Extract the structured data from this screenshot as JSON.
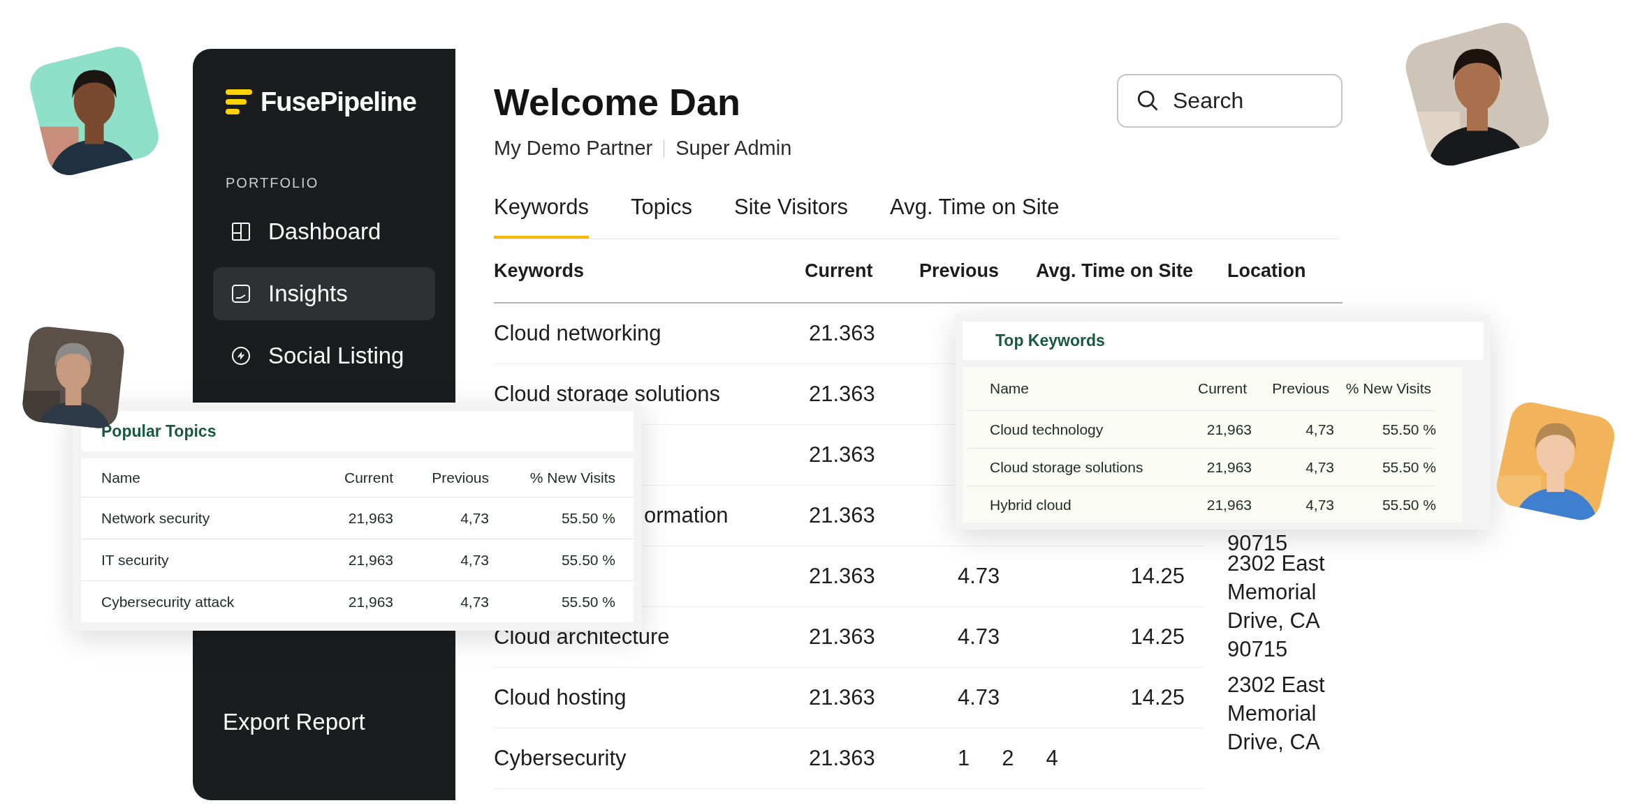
{
  "sidebar": {
    "logo": "FusePipeline",
    "section": "PORTFOLIO",
    "items": [
      {
        "label": "Dashboard",
        "kind": "dashboard",
        "selected": false
      },
      {
        "label": "Insights",
        "kind": "insights",
        "selected": true
      },
      {
        "label": "Social Listing",
        "kind": "social",
        "selected": false
      }
    ],
    "footer": "Export Report"
  },
  "header": {
    "title": "Welcome Dan",
    "organization": "My Demo Partner",
    "role": "Super Admin",
    "search": {
      "placeholder": "Search"
    }
  },
  "tabs": [
    {
      "label": "Keywords",
      "selected": true
    },
    {
      "label": "Topics",
      "selected": false
    },
    {
      "label": "Site Visitors",
      "selected": false
    },
    {
      "label": "Avg. Time on Site",
      "selected": false
    }
  ],
  "table": {
    "columns": [
      "Keywords",
      "Current",
      "Previous",
      "Avg. Time on Site",
      "Location"
    ],
    "rows": [
      {
        "keyword": "Cloud networking",
        "current": "21.363"
      },
      {
        "keyword": "Cloud storage solutions",
        "current": "21.363"
      },
      {
        "current": "21.363"
      },
      {
        "keyword": "ormation",
        "current": "21.363",
        "location": "90715",
        "kind": "cut"
      },
      {
        "current": "21.363",
        "previous": "4.73",
        "avg_time": "14.25",
        "location": "2302 East Memorial Drive, CA 90715"
      },
      {
        "keyword": "Cloud architecture",
        "current": "21.363",
        "previous": "4.73",
        "avg_time": "14.25"
      },
      {
        "keyword": "Cloud hosting",
        "current": "21.363",
        "previous": "4.73",
        "avg_time": "14.25",
        "location": "2302 East Memorial Drive, CA"
      },
      {
        "keyword": "Cybersecurity",
        "current": "21.363",
        "pages": [
          "1",
          "2",
          "4"
        ]
      }
    ]
  },
  "popular_topics": {
    "title": "Popular Topics",
    "columns": [
      "Name",
      "Current",
      "Previous",
      "% New Visits"
    ],
    "rows": [
      {
        "name": "Network security",
        "current": "21,963",
        "previous": "4,73",
        "new_visits": "55.50 %"
      },
      {
        "name": "IT security",
        "current": "21,963",
        "previous": "4,73",
        "new_visits": "55.50 %"
      },
      {
        "name": "Cybersecurity attack",
        "current": "21,963",
        "previous": "4,73",
        "new_visits": "55.50 %"
      }
    ]
  },
  "top_keywords": {
    "title": "Top Keywords",
    "columns": [
      "Name",
      "Current",
      "Previous",
      "% New Visits"
    ],
    "rows": [
      {
        "name": "Cloud technology",
        "current": "21,963",
        "previous": "4,73",
        "new_visits": "55.50 %"
      },
      {
        "name": "Cloud storage solutions",
        "current": "21,963",
        "previous": "4,73",
        "new_visits": "55.50 %"
      },
      {
        "name": "Hybrid cloud",
        "current": "21,963",
        "previous": "4,73",
        "new_visits": "55.50 %"
      }
    ]
  }
}
